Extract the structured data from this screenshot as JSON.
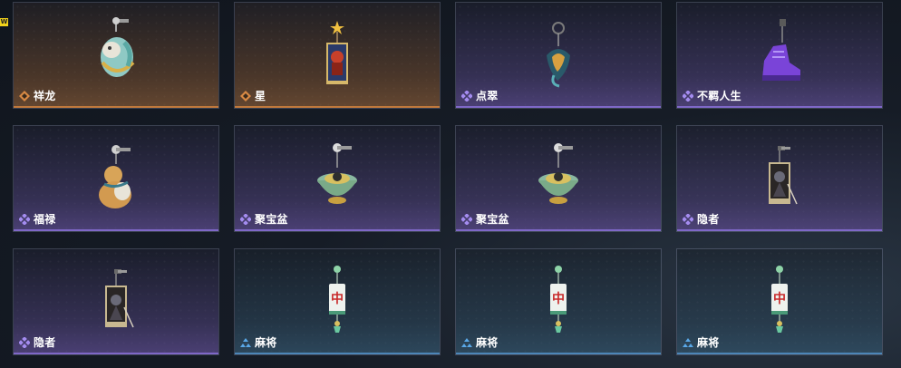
{
  "badge": {
    "text": "W"
  },
  "colors": {
    "orange": "#c0793c",
    "purple": "#7f68c8",
    "blue": "#4d86b8"
  },
  "items": [
    {
      "name": "祥龙",
      "rarity": "orange",
      "icon": "dragon-charm-icon"
    },
    {
      "name": "星",
      "rarity": "orange",
      "icon": "star-tarot-charm-icon"
    },
    {
      "name": "点翠",
      "rarity": "purple",
      "icon": "kingfisher-charm-icon"
    },
    {
      "name": "不羁人生",
      "rarity": "purple",
      "icon": "sneaker-charm-icon"
    },
    {
      "name": "福禄",
      "rarity": "purple",
      "icon": "gourd-charm-icon"
    },
    {
      "name": "聚宝盆",
      "rarity": "purple",
      "icon": "treasure-bowl-charm-icon"
    },
    {
      "name": "聚宝盆",
      "rarity": "purple",
      "icon": "treasure-bowl-charm-icon"
    },
    {
      "name": "隐者",
      "rarity": "purple",
      "icon": "hermit-tarot-charm-icon"
    },
    {
      "name": "隐者",
      "rarity": "purple",
      "icon": "hermit-tarot-charm-icon"
    },
    {
      "name": "麻将",
      "rarity": "blue",
      "icon": "mahjong-tile-charm-icon"
    },
    {
      "name": "麻将",
      "rarity": "blue",
      "icon": "mahjong-tile-charm-icon"
    },
    {
      "name": "麻将",
      "rarity": "blue",
      "icon": "mahjong-tile-charm-icon"
    }
  ],
  "mahjong_tile_char": "中"
}
